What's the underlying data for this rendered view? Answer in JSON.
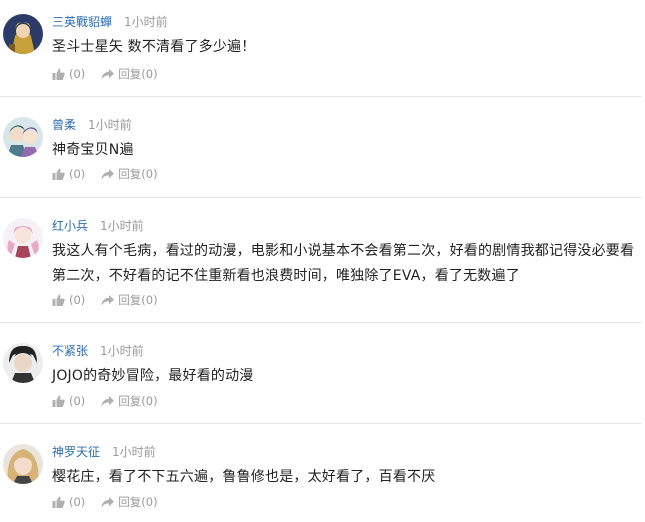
{
  "comments": [
    {
      "username": "三英戰貂蟬",
      "time": "1小时前",
      "text": "圣斗士星矢 数不清看了多少遍！",
      "like_count": "(0)",
      "reply_label": "回复",
      "reply_count": "(0)"
    },
    {
      "username": "曾柔",
      "time": "1小时前",
      "text": "神奇宝贝N遍",
      "like_count": "(0)",
      "reply_label": "回复",
      "reply_count": "(0)"
    },
    {
      "username": "红小兵",
      "time": "1小时前",
      "text": "我这人有个毛病，看过的动漫，电影和小说基本不会看第二次，好看的剧情我都记得没必要看第二次，不好看的记不住重新看也浪费时间，唯独除了EVA，看了无数遍了",
      "like_count": "(0)",
      "reply_label": "回复",
      "reply_count": "(0)"
    },
    {
      "username": "不紧张",
      "time": "1小时前",
      "text": "JOJO的奇妙冒险，最好看的动漫",
      "like_count": "(0)",
      "reply_label": "回复",
      "reply_count": "(0)"
    },
    {
      "username": "神罗天征",
      "time": "1小时前",
      "text": "樱花庄，看了不下五六遍，鲁鲁修也是，太好看了，百看不厌",
      "like_count": "(0)",
      "reply_label": "回复",
      "reply_count": "(0)"
    }
  ],
  "colors": {
    "username": "#2b6cb0",
    "meta": "#999999",
    "divider": "#e2e2e2"
  },
  "icons": {
    "like": "thumbs-up-icon",
    "reply": "share-arrow-icon"
  }
}
